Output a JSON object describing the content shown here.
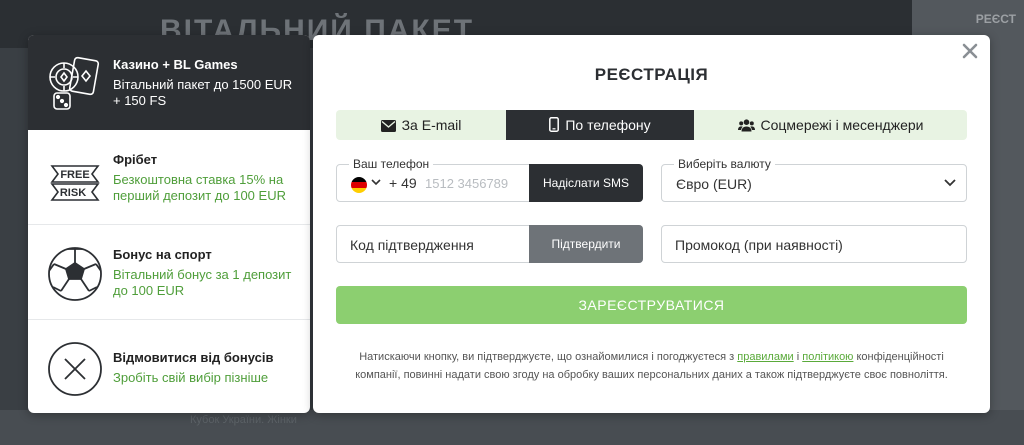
{
  "background": {
    "banner_title": "ВІТАЛЬНИЙ ПАКЕТ",
    "right_label": "РЕЄСТ",
    "bottom_text": "Кубок України. Жінки"
  },
  "bonuses": [
    {
      "title": "Казино + BL Games",
      "desc": "Вітальний пакет до 1500 EUR + 150 FS",
      "icon": "casino-chips-icon",
      "active": true
    },
    {
      "title": "Фрібет",
      "desc": "Безкоштовна ставка 15% на перший депозит до 100 EUR",
      "icon": "free-risk-icon",
      "icon_text_top": "FREE",
      "icon_text_bottom": "RISK"
    },
    {
      "title": "Бонус на спорт",
      "desc": "Вітальний бонус за 1 депозит до 100 EUR",
      "icon": "soccer-ball-icon"
    },
    {
      "title": "Відмовитися від бонусів",
      "desc": "Зробіть свій вибір пізніше",
      "icon": "close-circle-icon"
    }
  ],
  "modal": {
    "title": "РЕЄСТРАЦІЯ",
    "tabs": [
      {
        "label": "За E-mail",
        "icon": "envelope-icon"
      },
      {
        "label": "По телефону",
        "icon": "phone-icon",
        "active": true
      },
      {
        "label": "Соцмережі і месенджери",
        "icon": "users-icon"
      }
    ],
    "phone": {
      "label": "Ваш телефон",
      "country_code": "+ 49",
      "placeholder": "1512 3456789",
      "sms_button": "Надіслати SMS",
      "flag": "germany-flag-icon"
    },
    "currency": {
      "label": "Виберіть валюту",
      "value": "Євро (EUR)"
    },
    "code": {
      "placeholder": "Код підтвердження",
      "confirm_button": "Підтвердити"
    },
    "promo": {
      "placeholder": "Промокод (при наявності)"
    },
    "register_button": "ЗАРЕЄСТРУВАТИСЯ",
    "legal": {
      "text_before": "Натискаючи кнопку, ви підтверджуєте, що ознайомилися і погоджуєтеся з ",
      "link_rules": "правилами",
      "text_and": " і ",
      "link_policy": "політикою",
      "text_after": " конфіденційності компанії, повинні надати свою згоду на обробку ваших персональних даних а також підтверджуєте своє повноліття."
    }
  },
  "colors": {
    "accent_green": "#8ccf70",
    "link_green": "#5aaa3a",
    "dark": "#2c2f33"
  }
}
